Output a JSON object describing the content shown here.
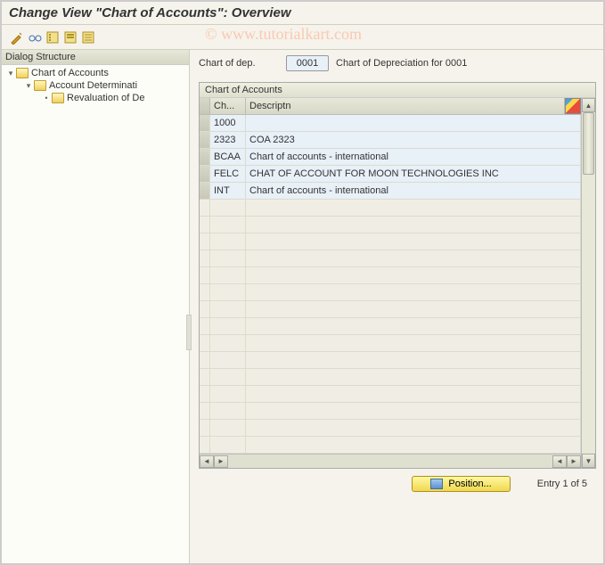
{
  "title": "Change View \"Chart of Accounts\": Overview",
  "watermark": "© www.tutorialkart.com",
  "toolbar": {
    "icons": [
      "wand-icon",
      "glasses-icon",
      "expand-icon",
      "collapse-icon",
      "list-icon"
    ]
  },
  "sidebar": {
    "header": "Dialog Structure",
    "tree": [
      {
        "level": 0,
        "toggle": "▾",
        "label": "Chart of Accounts"
      },
      {
        "level": 1,
        "toggle": "▾",
        "label": "Account Determinati"
      },
      {
        "level": 2,
        "toggle": "•",
        "label": "Revaluation of De"
      }
    ]
  },
  "fields": {
    "chart_of_dep_label": "Chart of dep.",
    "chart_of_dep_value": "0001",
    "chart_of_dep_desc": "Chart of Depreciation for 0001"
  },
  "table": {
    "title": "Chart of Accounts",
    "headers": {
      "col1": "Ch...",
      "col2": "Descriptn"
    },
    "rows": [
      {
        "code": "1000",
        "desc": ""
      },
      {
        "code": "2323",
        "desc": "COA 2323"
      },
      {
        "code": "BCAA",
        "desc": "Chart of accounts - international"
      },
      {
        "code": "FELC",
        "desc": "CHAT OF ACCOUNT FOR MOON TECHNOLOGIES INC"
      },
      {
        "code": "INT",
        "desc": "Chart of accounts - international"
      }
    ],
    "empty_rows": 15
  },
  "footer": {
    "position_label": "Position...",
    "entry_text": "Entry 1 of 5"
  }
}
